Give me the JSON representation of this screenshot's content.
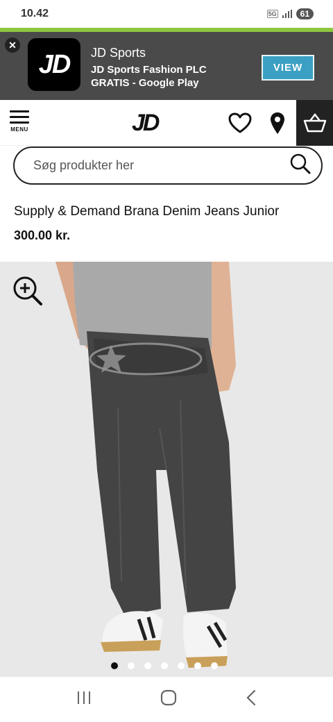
{
  "status": {
    "time": "10.42",
    "network": "5G",
    "battery": "61"
  },
  "banner": {
    "logo_text": "JD",
    "title": "JD Sports",
    "publisher": "JD Sports Fashion PLC",
    "price_store": "GRATIS - Google Play",
    "view_label": "VIEW",
    "accent_color": "#8dc63f"
  },
  "header": {
    "menu_label": "MENU",
    "logo_text": "JD"
  },
  "search": {
    "placeholder": "Søg produkter her"
  },
  "product": {
    "title": "Supply & Demand Brana Denim Jeans Junior",
    "price": "300.00 kr.",
    "gallery_count": 7,
    "gallery_active": 1
  },
  "icons": [
    "close-icon",
    "menu-icon",
    "heart-icon",
    "location-pin-icon",
    "basket-icon",
    "search-icon",
    "zoom-in-icon",
    "recents-icon",
    "home-icon",
    "back-icon"
  ]
}
